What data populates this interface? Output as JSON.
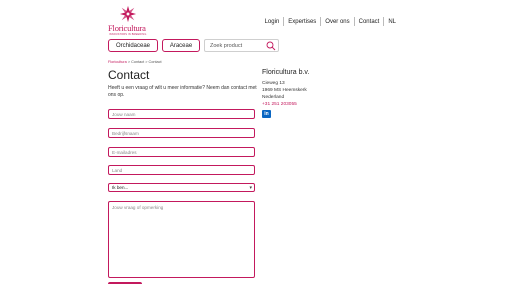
{
  "brand": {
    "name": "Floricultura",
    "tagline": "INNOVATORS IN BREEDING",
    "accent_color": "#c3195d",
    "logo_icon": "flower-logo-icon"
  },
  "topnav": {
    "items": [
      "Login",
      "Expertises",
      "Over ons",
      "Contact",
      "NL"
    ]
  },
  "categories": [
    "Orchidaceae",
    "Araceae"
  ],
  "search": {
    "placeholder": "Zoek product",
    "icon": "search-icon"
  },
  "breadcrumb": {
    "home": "Floricultura",
    "sep": " > ",
    "items": [
      "Contact",
      "Contact"
    ]
  },
  "main": {
    "title": "Contact",
    "intro": "Heeft u een vraag of wilt u meer informatie? Neem dan contact met ons op."
  },
  "form": {
    "name_placeholder": "Jouw naam",
    "company_placeholder": "Bedrijfsnaam",
    "email_placeholder": "E-mailadres",
    "country_placeholder": "Land",
    "role_selected": "Ik ben...",
    "message_placeholder": "Jouw vraag of opmerking"
  },
  "company": {
    "name": "Floricultura b.v.",
    "street": "Cieweg 13",
    "city": "1969 MS Heemskerk",
    "country": "Nederland",
    "phone": "+31 251 203055",
    "social_icon": "linkedin-icon",
    "social_label": "in"
  }
}
